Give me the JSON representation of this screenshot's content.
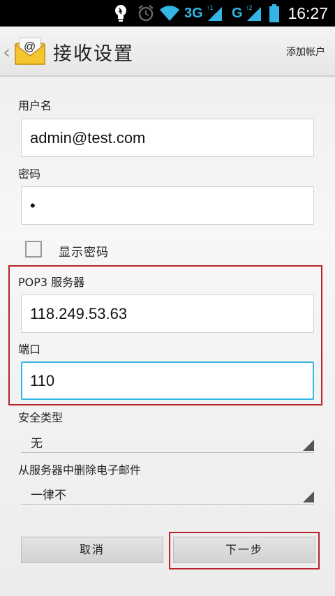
{
  "status_bar": {
    "network1": "3G",
    "network2": "G",
    "time": "16:27"
  },
  "action_bar": {
    "title": "接收设置",
    "action": "添加帐户"
  },
  "form": {
    "username_label": "用户名",
    "username_value": "admin@test.com",
    "password_label": "密码",
    "password_value": "•",
    "show_password_label": "显示密码",
    "server_label": "POP3 服务器",
    "server_value": "118.249.53.63",
    "port_label": "端口",
    "port_value": "110",
    "security_label": "安全类型",
    "security_value": "无",
    "delete_label": "从服务器中删除电子邮件",
    "delete_value": "一律不"
  },
  "buttons": {
    "cancel": "取消",
    "next": "下一步"
  },
  "colors": {
    "accent": "#33b5e5",
    "highlight": "#b5252b"
  }
}
